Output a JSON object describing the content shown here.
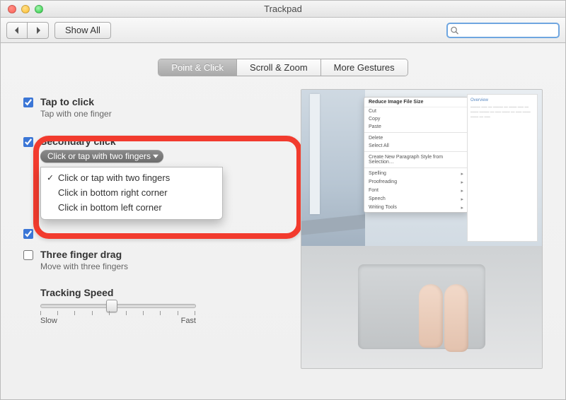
{
  "window": {
    "title": "Trackpad"
  },
  "toolbar": {
    "show_all": "Show All",
    "search_placeholder": ""
  },
  "tabs": {
    "point_click": "Point & Click",
    "scroll_zoom": "Scroll & Zoom",
    "more": "More Gestures"
  },
  "options": {
    "tap_to_click": {
      "title": "Tap to click",
      "sub": "Tap with one finger",
      "checked": true
    },
    "secondary_click": {
      "title": "Secondary click",
      "pill": "Click or tap with two fingers",
      "checked": true
    },
    "secondary_menu": {
      "opt1": "Click or tap with two fingers",
      "opt2": "Click in bottom right corner",
      "opt3": "Click in bottom left corner"
    },
    "look_up": {
      "checked": true
    },
    "three_finger_drag": {
      "title": "Three finger drag",
      "sub": "Move with three fingers",
      "checked": false
    },
    "tracking": {
      "title": "Tracking Speed",
      "slow": "Slow",
      "fast": "Fast"
    }
  },
  "preview_menu": {
    "header": "Reduce Image File Size",
    "items": [
      "Cut",
      "Copy",
      "Paste",
      "Delete",
      "Select All"
    ],
    "group2_header": "Create New Paragraph Style from Selection…",
    "group3": [
      "Spelling",
      "Proofreading",
      "Font",
      "Speech",
      "Writing Tools"
    ]
  },
  "preview_doc": {
    "heading": "Overview"
  }
}
